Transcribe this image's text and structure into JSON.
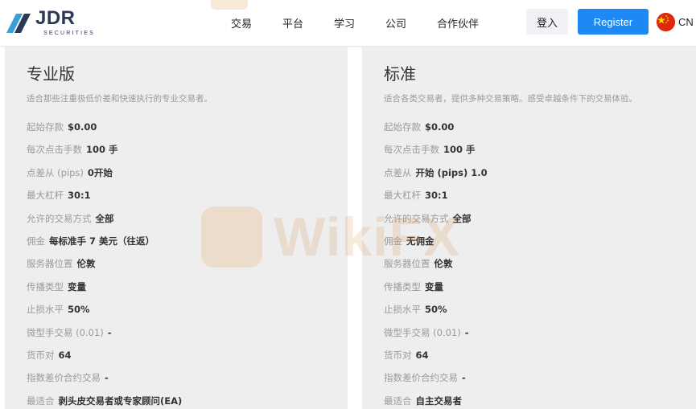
{
  "brand": {
    "name": "JDR",
    "subtitle": "SECURITIES"
  },
  "nav": {
    "items": [
      "交易",
      "平台",
      "学习",
      "公司",
      "合作伙伴"
    ]
  },
  "actions": {
    "login_label": "登入",
    "register_label": "Register",
    "language_label": "CN"
  },
  "colors": {
    "accent": "#1e88f5",
    "card_background": "#eeeeee",
    "brand_text": "#2b3a55",
    "watermark": "#d58a3f"
  },
  "watermark": {
    "text": "WikiFX"
  },
  "plans": [
    {
      "title": "专业版",
      "description": "适合那些注重极低价差和快速执行的专业交易者。",
      "specs": [
        {
          "label": "起始存款",
          "value": "$0.00"
        },
        {
          "label": "每次点击手数",
          "value": "100 手"
        },
        {
          "label": "点差从 (pips)",
          "value": "0开始"
        },
        {
          "label": "最大杠杆",
          "value": "30:1"
        },
        {
          "label": "允许的交易方式",
          "value": "全部"
        },
        {
          "label": "佣金",
          "value": "每标准手 7 美元（往返）"
        },
        {
          "label": "服务器位置",
          "value": "伦敦"
        },
        {
          "label": "传播类型",
          "value": "变量"
        },
        {
          "label": "止损水平",
          "value": "50%"
        },
        {
          "label": "微型手交易 (0.01)",
          "value": "-"
        },
        {
          "label": "货币对",
          "value": "64"
        },
        {
          "label": "指数差价合约交易",
          "value": "-"
        },
        {
          "label": "最适合",
          "value": "剥头皮交易者或专家顾问(EA)"
        }
      ]
    },
    {
      "title": "标准",
      "description": "适合各类交易者，提供多种交易策略。感受卓越条件下的交易体验。",
      "specs": [
        {
          "label": "起始存款",
          "value": "$0.00"
        },
        {
          "label": "每次点击手数",
          "value": "100 手"
        },
        {
          "label": "点差从",
          "value": "开始 (pips) 1.0"
        },
        {
          "label": "最大杠杆",
          "value": "30:1"
        },
        {
          "label": "允许的交易方式",
          "value": "全部"
        },
        {
          "label": "佣金",
          "value": "无佣金"
        },
        {
          "label": "服务器位置",
          "value": "伦敦"
        },
        {
          "label": "传播类型",
          "value": "变量"
        },
        {
          "label": "止损水平",
          "value": "50%"
        },
        {
          "label": "微型手交易 (0.01)",
          "value": "-"
        },
        {
          "label": "货币对",
          "value": "64"
        },
        {
          "label": "指数差价合约交易",
          "value": "-"
        },
        {
          "label": "最适合",
          "value": "自主交易者"
        }
      ]
    }
  ]
}
